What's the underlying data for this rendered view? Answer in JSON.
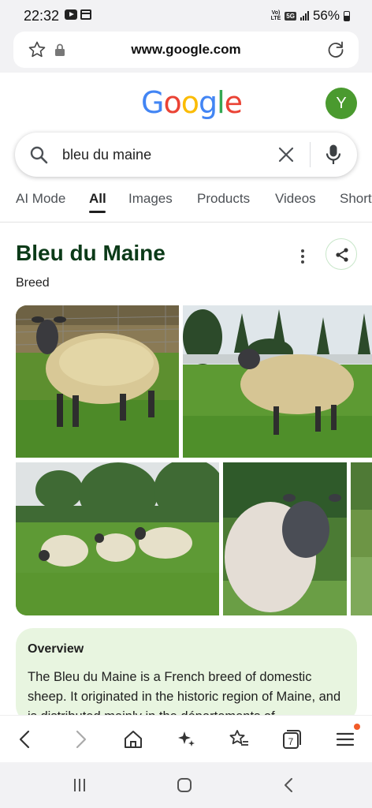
{
  "status_bar": {
    "time": "22:32",
    "volte": "Vo) LTE",
    "network": "5G",
    "battery": "56%"
  },
  "browser": {
    "url": "www.google.com"
  },
  "google": {
    "logo_letters": [
      {
        "ch": "G",
        "color": "#4285F4"
      },
      {
        "ch": "o",
        "color": "#EA4335"
      },
      {
        "ch": "o",
        "color": "#FBBC05"
      },
      {
        "ch": "g",
        "color": "#4285F4"
      },
      {
        "ch": "l",
        "color": "#34A853"
      },
      {
        "ch": "e",
        "color": "#EA4335"
      }
    ],
    "avatar_letter": "Y",
    "avatar_color": "#4a9a2f"
  },
  "search": {
    "query": "bleu du maine"
  },
  "tabs": [
    "AI Mode",
    "All",
    "Images",
    "Products",
    "Videos",
    "Short"
  ],
  "active_tab": "All",
  "knowledge_panel": {
    "title": "Bleu du Maine",
    "subtitle": "Breed",
    "overview_heading": "Overview",
    "overview_text": "The Bleu du Maine is a French breed of domestic sheep. It originated in the historic region of Maine, and is distributed mainly in the départements of"
  },
  "browser_nav": {
    "tab_count": "7"
  },
  "colors": {
    "title_green": "#0b3a18",
    "overview_bg": "#e8f5e0",
    "menu_notification": "#f15b28"
  }
}
